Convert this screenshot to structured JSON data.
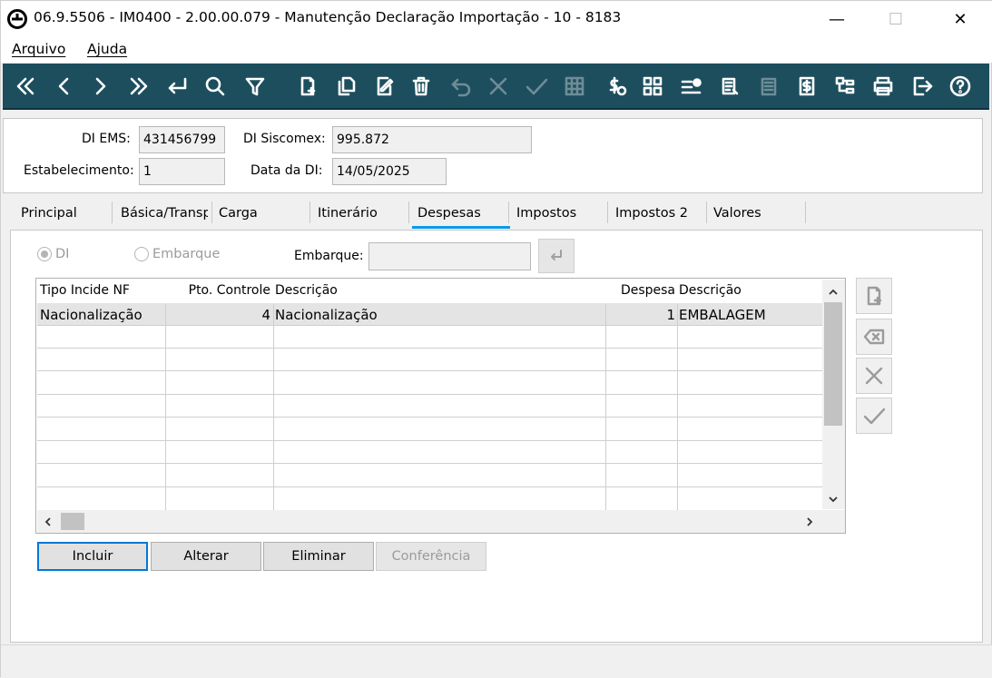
{
  "window": {
    "title": "06.9.5506 - IM0400 - 2.00.00.079 - Manutenção Declaração Importação - 10 - 8183",
    "minimize_glyph": "—",
    "maximize_glyph": "☐",
    "close_glyph": "✕"
  },
  "menu": {
    "items": [
      "Arquivo",
      "Ajuda"
    ]
  },
  "toolbar": {
    "icons": [
      "first-icon",
      "prev-icon",
      "next-icon",
      "last-icon",
      "goto-icon",
      "search-icon",
      "filter-icon",
      "new-icon",
      "copy-icon",
      "edit-icon",
      "delete-icon",
      "undo-icon",
      "cancel-icon",
      "confirm-icon",
      "grid-icon",
      "dollar-search-icon",
      "apps-icon",
      "list-icon",
      "report-icon",
      "notes-icon",
      "money-doc-icon",
      "tree-icon",
      "print-icon",
      "exit-icon",
      "help-icon"
    ]
  },
  "header": {
    "di_ems_label": "DI EMS:",
    "di_ems_value": "431456799",
    "di_siscomex_label": "DI Siscomex:",
    "di_siscomex_value": "995.872",
    "estabelecimento_label": "Estabelecimento:",
    "estabelecimento_value": "1",
    "data_di_label": "Data da DI:",
    "data_di_value": "14/05/2025"
  },
  "tabs": [
    "Principal",
    "Básica/Transporte",
    "Carga",
    "Itinerário",
    "Despesas",
    "Impostos",
    "Impostos 2",
    "Valores"
  ],
  "active_tab": "Despesas",
  "filter": {
    "radio_di": "DI",
    "radio_embarque": "Embarque",
    "selected": "DI",
    "embarque_label": "Embarque:",
    "embarque_value": ""
  },
  "grid": {
    "columns": [
      "Tipo Incide NF",
      "Pto. Controle",
      "Descrição",
      "Despesa",
      "Descrição"
    ],
    "rows": [
      [
        "Nacionalização",
        "4",
        "Nacionalização",
        "1",
        "EMBALAGEM"
      ]
    ]
  },
  "buttons": {
    "incluir": "Incluir",
    "alterar": "Alterar",
    "eliminar": "Eliminar",
    "conferencia": "Conferência"
  },
  "colors": {
    "toolbar_bg": "#1d4e5e",
    "active_tab_underline": "#0a9ae8"
  }
}
